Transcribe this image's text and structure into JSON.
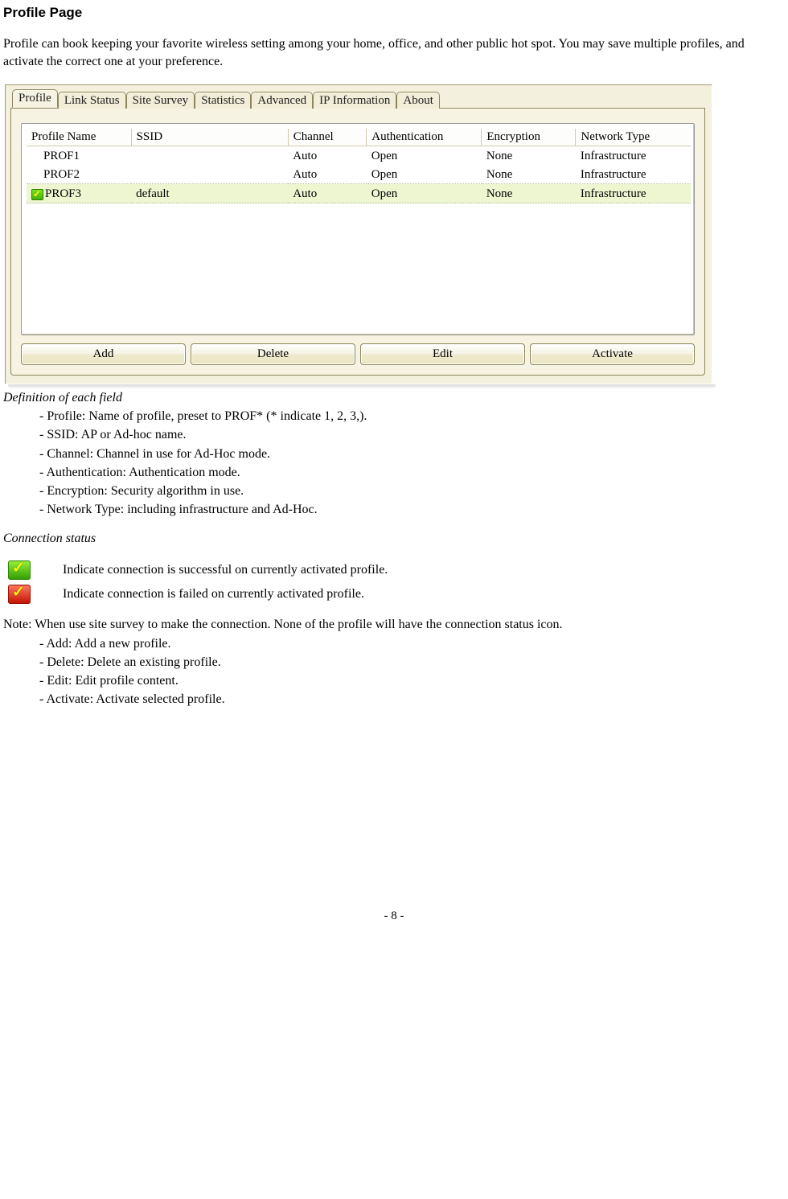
{
  "heading": "Profile Page",
  "intro": "Profile can book keeping your favorite wireless setting among your home, office, and other public hot spot. You may save multiple profiles, and activate the correct one at your preference.",
  "tabs": [
    {
      "label": "Profile",
      "active": true
    },
    {
      "label": "Link Status",
      "active": false
    },
    {
      "label": "Site Survey",
      "active": false
    },
    {
      "label": "Statistics",
      "active": false
    },
    {
      "label": "Advanced",
      "active": false
    },
    {
      "label": "IP Information",
      "active": false
    },
    {
      "label": "About",
      "active": false
    }
  ],
  "columns": [
    "Profile Name",
    "SSID",
    "Channel",
    "Authentication",
    "Encryption",
    "Network Type"
  ],
  "rows": [
    {
      "status": "none",
      "cells": [
        "PROF1",
        "",
        "Auto",
        "Open",
        "None",
        "Infrastructure"
      ]
    },
    {
      "status": "none",
      "cells": [
        "PROF2",
        "",
        "Auto",
        "Open",
        "None",
        "Infrastructure"
      ]
    },
    {
      "status": "green",
      "cells": [
        "PROF3",
        "default",
        "Auto",
        "Open",
        "None",
        "Infrastructure"
      ]
    }
  ],
  "buttons": [
    "Add",
    "Delete",
    "Edit",
    "Activate"
  ],
  "defHead": "Definition of each field",
  "definitions": [
    "Profile: Name of profile, preset to PROF* (* indicate 1, 2, 3,).",
    "SSID: AP or Ad-hoc name.",
    "Channel: Channel in use for Ad-Hoc mode.",
    "Authentication: Authentication mode.",
    "Encryption: Security algorithm in use.",
    "Network Type: including infrastructure and Ad-Hoc."
  ],
  "connHead": "Connection status",
  "legend": [
    {
      "icon": "green",
      "text": "Indicate connection is successful on currently activated profile."
    },
    {
      "icon": "red",
      "text": "Indicate connection is failed on currently activated profile."
    }
  ],
  "noteLead": "Note: When use site survey to make the connection. None of the profile will have the connection status icon.",
  "noteItems": [
    "Add: Add a new profile.",
    "Delete: Delete an existing profile.",
    "Edit: Edit profile content.",
    "Activate: Activate selected profile."
  ],
  "pageNumber": "- 8 -"
}
